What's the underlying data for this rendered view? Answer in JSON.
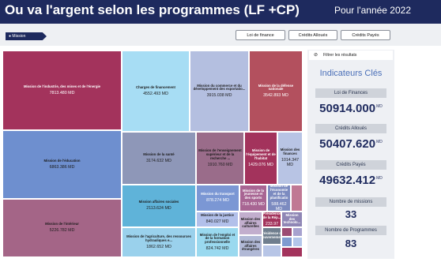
{
  "header": {
    "title": "Ou va l'argent selon les programmes (LF +CP)",
    "year": "Pour l'année 2022"
  },
  "toolbar": {
    "tag": "Mission",
    "buttons": [
      "Loi de finance",
      "Crédits Alloués",
      "Crédits Payés"
    ]
  },
  "treemap": [
    {
      "name": "Mission de l'industrie, des mines et de l'énergie",
      "value": "7813.480 MD",
      "color": "#a3335c"
    },
    {
      "name": "Mission de l'éducation",
      "value": "6863.386 MD",
      "color": "#6e8fcf"
    },
    {
      "name": "Mission de l'intérieur",
      "value": "5226.782 MD",
      "color": "#a46587"
    },
    {
      "name": "Charges de financement",
      "value": "4552.493 MD",
      "color": "#a7ddf4"
    },
    {
      "name": "Mission du commerce et du développement des exportatio...",
      "value": "3915.038 MD",
      "color": "#b4bfe0"
    },
    {
      "name": "Mission de la défense nationale",
      "value": "3542.893 MD",
      "color": "#b3505e"
    },
    {
      "name": "Mission de la santé",
      "value": "3174.632 MD",
      "color": "#8e97b8"
    },
    {
      "name": "Mission de l'enseignement supérieur et de la recherche ...",
      "value": "1910.760 MD",
      "color": "#9a6c8a"
    },
    {
      "name": "Mission de l'équipement et de l'habitat",
      "value": "1429.076 MD",
      "color": "#a3335c"
    },
    {
      "name": "Mission des finances",
      "value": "1014.347 MD",
      "color": "#b8c4e4"
    },
    {
      "name": "Mission affaires sociales",
      "value": "2113.624 MD",
      "color": "#5fb3d9"
    },
    {
      "name": "Mission du transport",
      "value": "878.274 MD",
      "color": "#7b97d4"
    },
    {
      "name": "Mission de la jeunesse et des sports",
      "value": "718.430 MD",
      "color": "#a86593"
    },
    {
      "name": "Mission de l'économie et de la planificatio",
      "value": "588.462 MD",
      "color": "#7c8bc0"
    },
    {
      "name": "Mission de l'agriculture, des ressources hydrauliques e...",
      "value": "1862.652 MD",
      "color": "#9ad1ec"
    },
    {
      "name": "Mission de la justice",
      "value": "840.027 MD",
      "color": "#b2c0ea"
    },
    {
      "name": "Mission de l'emploi et de la formation professionnelle",
      "value": "824.742 MD",
      "color": "#9ad9ef"
    },
    {
      "name": "Mission des affaires culturelles",
      "value": "",
      "color": "#c2aecd"
    },
    {
      "name": "Mission des affaires étrangères",
      "value": "",
      "color": "#b1b9d6"
    },
    {
      "name": "Présidence de la Rép...",
      "value": "233.97",
      "color": "#a3335c"
    },
    {
      "name": "Présidence du gouvernement",
      "value": "",
      "color": "#6f7e8e"
    },
    {
      "name": "Mission des technolo...",
      "value": "",
      "color": "#8f86b5"
    },
    {
      "name": "",
      "value": "",
      "color": "#9b4b73"
    },
    {
      "name": "",
      "value": "",
      "color": "#a7a2cf"
    },
    {
      "name": "",
      "value": "",
      "color": "#7e9bd0"
    },
    {
      "name": "",
      "value": "",
      "color": "#c07894"
    },
    {
      "name": "",
      "value": "",
      "color": "#b3c6ea"
    },
    {
      "name": "",
      "value": "",
      "color": "#a3335c"
    }
  ],
  "sidebar": {
    "filter_label": "Filtrer les résultats",
    "filter_icon": "eye-slash-icon",
    "indicators_title": "Indicateurs Clés",
    "kpis": [
      {
        "label": "Loi de Finances",
        "value": "50914.000",
        "unit": "MD"
      },
      {
        "label": "Crédits Alloués",
        "value": "50407.620",
        "unit": "MD"
      },
      {
        "label": "Crédits Payés",
        "value": "49632.412",
        "unit": "MD"
      },
      {
        "label": "Nombre de missions",
        "value": "33",
        "unit": ""
      },
      {
        "label": "Nombre de Programmes",
        "value": "83",
        "unit": ""
      }
    ]
  }
}
